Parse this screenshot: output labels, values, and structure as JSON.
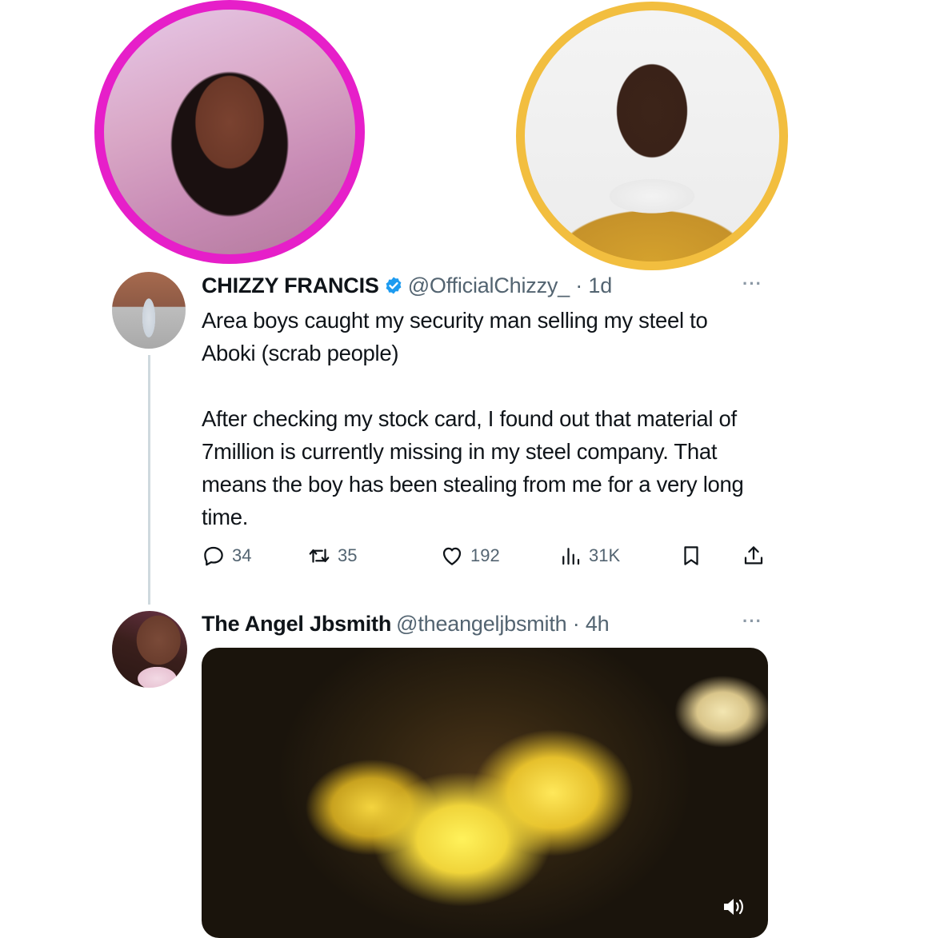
{
  "tweet1": {
    "display_name": "CHIZZY FRANCIS",
    "handle_time": "@OfficialChizzy_ · 1d",
    "more": "···",
    "text_p1": "Area boys caught my security man selling my steel to Aboki (scrab people)",
    "text_p2": "After checking my stock card, I found out that material of 7million is currently missing in my steel company. That means the boy has been stealing from me for a very long time.",
    "stats": {
      "replies": "34",
      "retweets": "35",
      "likes": "192",
      "views": "31K"
    }
  },
  "tweet2": {
    "display_name": "The Angel Jbsmith",
    "handle_time": "@theangeljbsmith · 4h",
    "more": "···"
  },
  "icons": {
    "verified": "verified-badge-icon",
    "reply": "reply-icon",
    "retweet": "retweet-icon",
    "like": "heart-icon",
    "views": "views-icon",
    "bookmark": "bookmark-icon",
    "share": "share-icon",
    "volume": "volume-icon"
  },
  "colors": {
    "left_ring": "#e61fc9",
    "right_ring": "#f2be3f",
    "verified": "#1d9bf0",
    "muted_text": "#536471"
  }
}
